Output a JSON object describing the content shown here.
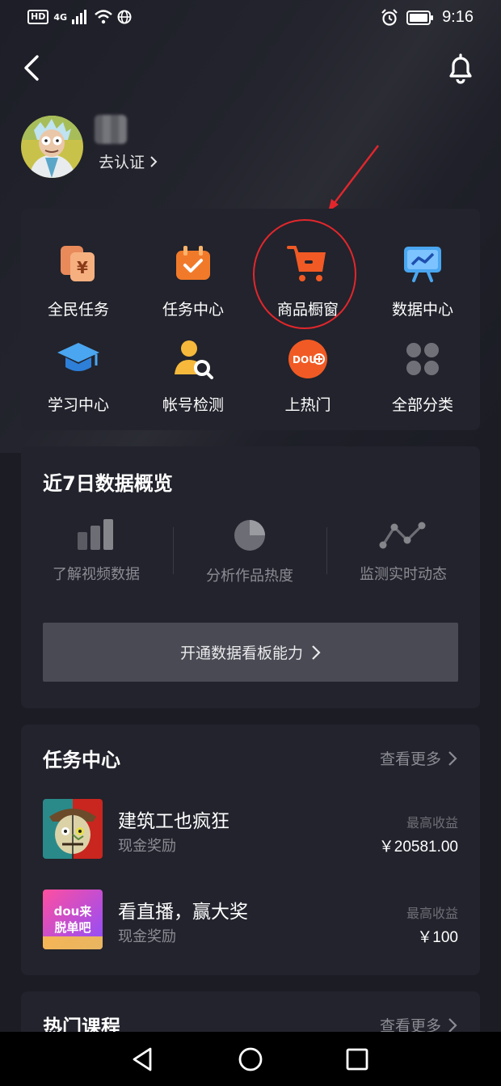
{
  "status_bar": {
    "left_badge": "HD",
    "network": "4G",
    "time": "9:16"
  },
  "profile": {
    "verify_label": "去认证"
  },
  "tools": [
    {
      "label": "全民任务",
      "icon": "money-cards-icon"
    },
    {
      "label": "任务中心",
      "icon": "task-calendar-icon"
    },
    {
      "label": "商品橱窗",
      "icon": "shopping-cart-icon"
    },
    {
      "label": "数据中心",
      "icon": "data-board-icon"
    },
    {
      "label": "学习中心",
      "icon": "graduation-cap-icon"
    },
    {
      "label": "帐号检测",
      "icon": "user-search-icon"
    },
    {
      "label": "上热门",
      "icon": "dou-plus-icon"
    },
    {
      "label": "全部分类",
      "icon": "all-categories-icon"
    }
  ],
  "data_overview": {
    "title": "近7日数据概览",
    "metrics": [
      {
        "label": "了解视频数据",
        "icon": "bar-chart-icon"
      },
      {
        "label": "分析作品热度",
        "icon": "pie-chart-icon"
      },
      {
        "label": "监测实时动态",
        "icon": "line-trend-icon"
      }
    ],
    "cta_label": "开通数据看板能力"
  },
  "task_center": {
    "title": "任务中心",
    "more_label": "查看更多",
    "tasks": [
      {
        "name": "建筑工也疯狂",
        "reward_type": "现金奖励",
        "earn_label": "最高收益",
        "earn_value": "￥20581.00"
      },
      {
        "name": "看直播，赢大奖",
        "reward_type": "现金奖励",
        "earn_label": "最高收益",
        "earn_value": "￥100",
        "thumb_text": "dou来脱单吧"
      }
    ]
  },
  "hot_courses": {
    "title": "热门课程",
    "more_label": "查看更多"
  },
  "colors": {
    "background": "#1b1c24",
    "card": "#22232c",
    "accent_orange": "#f15a24",
    "highlight_red": "#e3262c",
    "muted_text": "#8b8c93"
  }
}
